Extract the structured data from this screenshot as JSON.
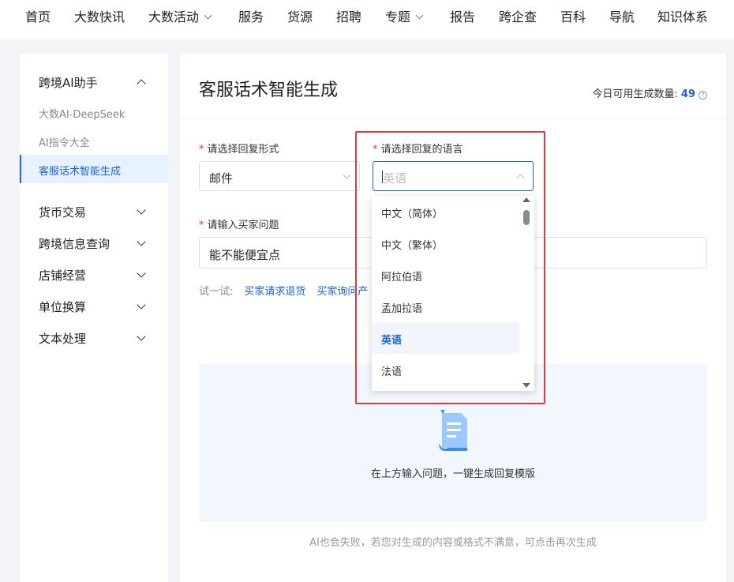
{
  "nav": {
    "items": [
      {
        "label": "首页",
        "dropdown": false
      },
      {
        "label": "大数快讯",
        "dropdown": false
      },
      {
        "label": "大数活动",
        "dropdown": true
      },
      {
        "label": "服务",
        "dropdown": false
      },
      {
        "label": "货源",
        "dropdown": false
      },
      {
        "label": "招聘",
        "dropdown": false
      },
      {
        "label": "专题",
        "dropdown": true
      },
      {
        "label": "报告",
        "dropdown": false
      },
      {
        "label": "跨企查",
        "dropdown": false
      },
      {
        "label": "百科",
        "dropdown": false
      },
      {
        "label": "导航",
        "dropdown": false
      },
      {
        "label": "知识体系",
        "dropdown": false
      }
    ]
  },
  "sidebar": {
    "groups": [
      {
        "label": "跨境AI助手",
        "expanded": true
      },
      {
        "label": "货币交易",
        "expanded": false
      },
      {
        "label": "跨境信息查询",
        "expanded": false
      },
      {
        "label": "店铺经营",
        "expanded": false
      },
      {
        "label": "单位换算",
        "expanded": false
      },
      {
        "label": "文本处理",
        "expanded": false
      }
    ],
    "sub_items": [
      "大数AI-DeepSeek",
      "AI指令大全"
    ],
    "active_item": "客服话术智能生成"
  },
  "main": {
    "title": "客服话术智能生成",
    "quota_label": "今日可用生成数量:",
    "quota_value": "49",
    "quota_help": "?",
    "form": {
      "reply_format_label": "请选择回复形式",
      "reply_format_value": "邮件",
      "language_label": "请选择回复的语言",
      "language_placeholder": "英语",
      "question_label": "请输入买家问题",
      "question_value": "能不能便宜点",
      "required_mark": "*"
    },
    "try_row": {
      "label": "试一试:",
      "links": [
        "买家请求退货",
        "买家询问产"
      ]
    },
    "empty_state_text": "在上方输入问题，一键生成回复模版",
    "footer_note": "AI也会失败，若您对生成的内容或格式不满意，可点击再次生成"
  },
  "language_dropdown": {
    "options": [
      "中文（简体）",
      "中文（繁体）",
      "阿拉伯语",
      "孟加拉语",
      "英语",
      "法语"
    ],
    "selected": "英语"
  },
  "colors": {
    "accent": "#1a62d6",
    "required": "#e0393e",
    "highlight_box": "#e0393e",
    "empty_area_bg": "#f2f7fe"
  }
}
